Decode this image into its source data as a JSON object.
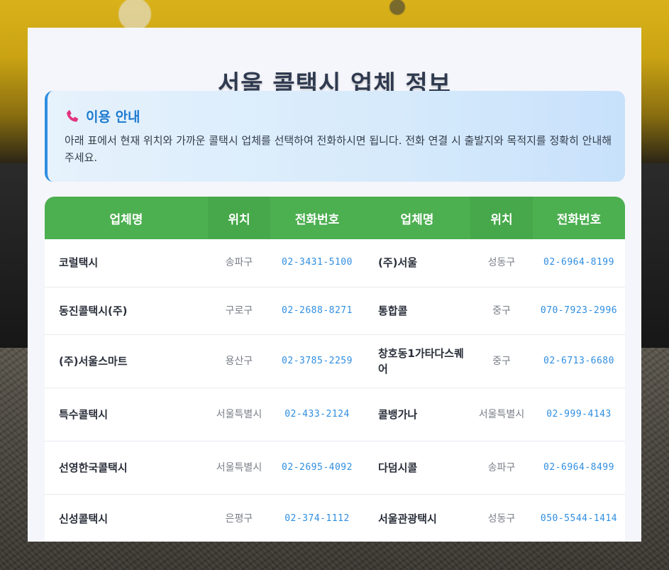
{
  "page": {
    "title": "서울 콜택시 업체 정보"
  },
  "notice": {
    "icon": "phone-icon",
    "title": "이용 안내",
    "text": "아래 표에서 현재 위치와 가까운 콜택시 업체를 선택하여 전화하시면 됩니다. 전화 연결 시 출발지와 목적지를 정확히 안내해 주세요."
  },
  "table": {
    "headers": [
      "업체명",
      "위치",
      "전화번호",
      "업체명",
      "위치",
      "전화번호"
    ],
    "rows": [
      [
        {
          "name": "코럴택시",
          "location": "송파구",
          "phone": "02-3431-5100"
        },
        {
          "name": "(주)서울",
          "location": "성동구",
          "phone": "02-6964-8199"
        }
      ],
      [
        {
          "name": "동진콜택시(주)",
          "location": "구로구",
          "phone": "02-2688-8271"
        },
        {
          "name": "통합콜",
          "location": "중구",
          "phone": "070-7923-2996"
        }
      ],
      [
        {
          "name": "(주)서울스마트",
          "location": "용산구",
          "phone": "02-3785-2259"
        },
        {
          "name": "창호동1가타다스퀘어",
          "location": "중구",
          "phone": "02-6713-6680"
        }
      ],
      [
        {
          "name": "특수콜택시",
          "location": "서울특별시",
          "phone": "02-433-2124"
        },
        {
          "name": "콜뱅가나",
          "location": "서울특별시",
          "phone": "02-999-4143"
        }
      ],
      [
        {
          "name": "선영한국콜택시",
          "location": "서울특별시",
          "phone": "02-2695-4092"
        },
        {
          "name": "다덤시콜",
          "location": "송파구",
          "phone": "02-6964-8499"
        }
      ],
      [
        {
          "name": "신성콜택시",
          "location": "은평구",
          "phone": "02-374-1112"
        },
        {
          "name": "서울관광택시",
          "location": "성동구",
          "phone": "050-5544-1414"
        }
      ]
    ]
  },
  "colors": {
    "header_green": "#4caf50",
    "accent_blue": "#2f8ee0",
    "title_text": "#2f3a4f"
  }
}
